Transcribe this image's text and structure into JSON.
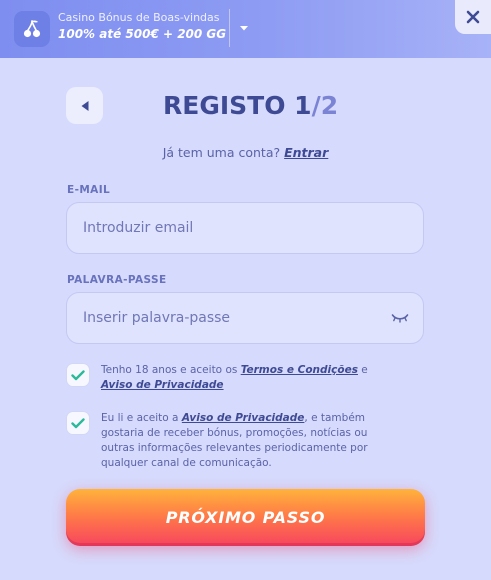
{
  "banner": {
    "title": "Casino Bónus de Boas-vindas",
    "offer": "100% até 500€ + 200 GG",
    "icon": "cherries-icon",
    "dropdown_icon": "caret-down-icon",
    "close_icon": "close-icon"
  },
  "header": {
    "title": "REGISTO 1",
    "step_total": "/2",
    "back_icon": "triangle-left-icon"
  },
  "login": {
    "prompt": "Já tem uma conta?",
    "link": "Entrar"
  },
  "form": {
    "email": {
      "label": "E-MAIL",
      "placeholder": "Introduzir email",
      "value": ""
    },
    "password": {
      "label": "PALAVRA-PASSE",
      "placeholder": "Inserir palavra-passe",
      "value": "",
      "toggle_icon": "eye-closed-icon"
    },
    "consents": [
      {
        "checked": true,
        "text_before": "Tenho 18 anos e aceito os ",
        "link1": "Termos e Condições",
        "text_between": " e ",
        "link2": "Aviso de Privacidade",
        "text_after": ""
      },
      {
        "checked": true,
        "text_before": "Eu li e aceito a ",
        "link1": "Aviso de Privacidade",
        "text_after": ", e também gostaria de receber bónus, promoções, notícias ou outras informações relevantes periodicamente por qualquer canal de comunicação."
      }
    ],
    "submit_label": "PRÓXIMO PASSO"
  },
  "colors": {
    "background": "#d6dafc",
    "banner": "#8e9cf3",
    "title": "#3f4a94",
    "accent_check": "#2db89a",
    "cta_top": "#ffb33b",
    "cta_bottom": "#f7445f"
  }
}
